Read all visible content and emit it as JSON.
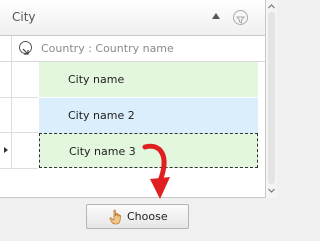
{
  "grid": {
    "column_header": "City",
    "group_row": {
      "label": "Country : Country name"
    },
    "rows": [
      {
        "label": "City name"
      },
      {
        "label": "City name 2"
      },
      {
        "label": "City name 3",
        "current": true
      }
    ]
  },
  "choose_button": {
    "label": "Choose"
  },
  "colors": {
    "row_green": "#e2f7de",
    "row_blue": "#daeefb",
    "arrow_red": "#e02020"
  },
  "icons": [
    "sort-ascending-icon",
    "filter-icon",
    "collapse-group-icon",
    "current-row-arrow-icon",
    "hand-pointer-icon",
    "red-pointer-arrow-icon"
  ]
}
